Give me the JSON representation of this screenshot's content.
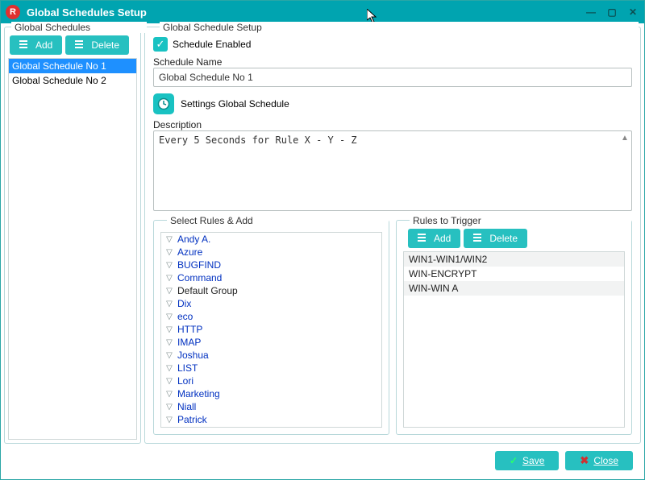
{
  "window": {
    "title": "Global Schedules Setup",
    "logo_letter": "R"
  },
  "left": {
    "group_label": "Global Schedules",
    "add_label": "Add",
    "delete_label": "Delete",
    "items": [
      "Global Schedule No 1",
      "Global Schedule No 2"
    ],
    "selected_index": 0
  },
  "right": {
    "group_label": "Global Schedule Setup",
    "schedule_enabled_label": "Schedule Enabled",
    "schedule_enabled": true,
    "name_label": "Schedule Name",
    "name_value": "Global Schedule No 1",
    "settings_label": "Settings Global Schedule",
    "desc_label": "Description",
    "desc_value": "Every 5 Seconds for Rule X - Y - Z"
  },
  "select_rules": {
    "group_label": "Select Rules & Add",
    "items": [
      {
        "label": "Andy A.",
        "blue": true
      },
      {
        "label": "Azure",
        "blue": true
      },
      {
        "label": "BUGFIND",
        "blue": true
      },
      {
        "label": "Command",
        "blue": true
      },
      {
        "label": "Default Group",
        "blue": false
      },
      {
        "label": "Dix",
        "blue": true
      },
      {
        "label": "eco",
        "blue": true
      },
      {
        "label": "HTTP",
        "blue": true
      },
      {
        "label": "IMAP",
        "blue": true
      },
      {
        "label": "Joshua",
        "blue": true
      },
      {
        "label": "LIST",
        "blue": true
      },
      {
        "label": "Lori",
        "blue": true
      },
      {
        "label": "Marketing",
        "blue": true
      },
      {
        "label": "Niall",
        "blue": true
      },
      {
        "label": "Patrick",
        "blue": true
      }
    ]
  },
  "rules_trigger": {
    "group_label": "Rules to Trigger",
    "add_label": "Add",
    "delete_label": "Delete",
    "items": [
      "WIN1-WIN1/WIN2",
      "WIN-ENCRYPT",
      "WIN-WIN A"
    ]
  },
  "footer": {
    "save_label": "Save",
    "close_label": "Close"
  },
  "icons": {
    "checkmark": "✓",
    "gear": "◎",
    "x": "✖",
    "chev": "▽"
  }
}
